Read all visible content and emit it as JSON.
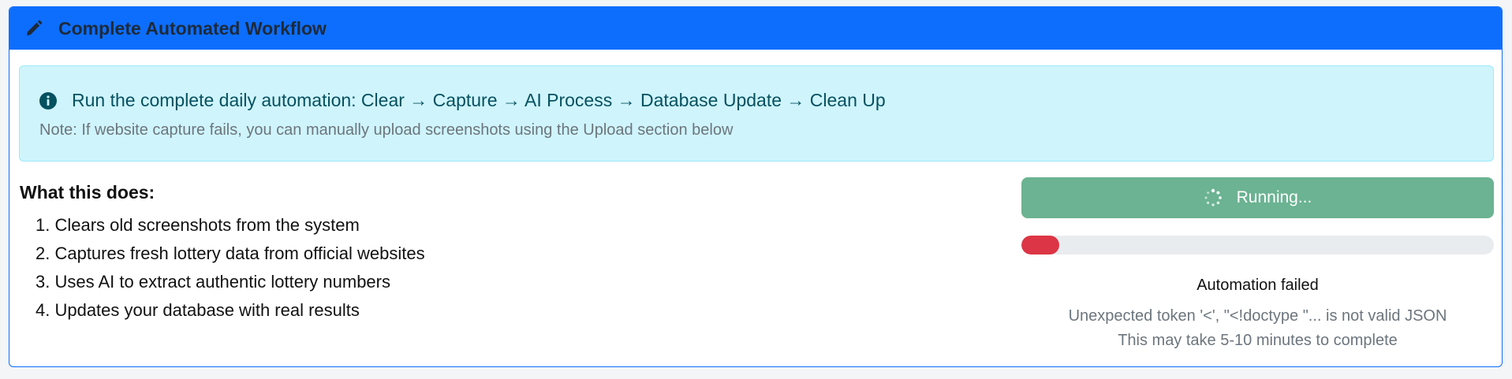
{
  "card": {
    "title": "Complete Automated Workflow",
    "icon": "pencil-icon"
  },
  "alert": {
    "icon": "info-circle-icon",
    "main_text": "Run the complete daily automation: Clear → Capture → AI Process → Database Update → Clean Up",
    "note_text": "Note: If website capture fails, you can manually upload screenshots using the Upload section below"
  },
  "description": {
    "title": "What this does:",
    "steps": [
      "1. Clears old screenshots from the system",
      "2. Captures fresh lottery data from official websites",
      "3. Uses AI to extract authentic lottery numbers",
      "4. Updates your database with real results"
    ]
  },
  "controls": {
    "run_button_label": "Running...",
    "spinner_icon": "spinner-icon",
    "progress_fraction": 0.08,
    "progress_color": "#dc3545",
    "status_text": "Automation failed",
    "error_text": "Unexpected token '<', \"<!doctype \"... is not valid JSON",
    "time_note": "This may take 5-10 minutes to complete"
  },
  "colors": {
    "header": "#0d6efd",
    "alert_bg": "#cff4fc",
    "button": "#6bb392"
  }
}
